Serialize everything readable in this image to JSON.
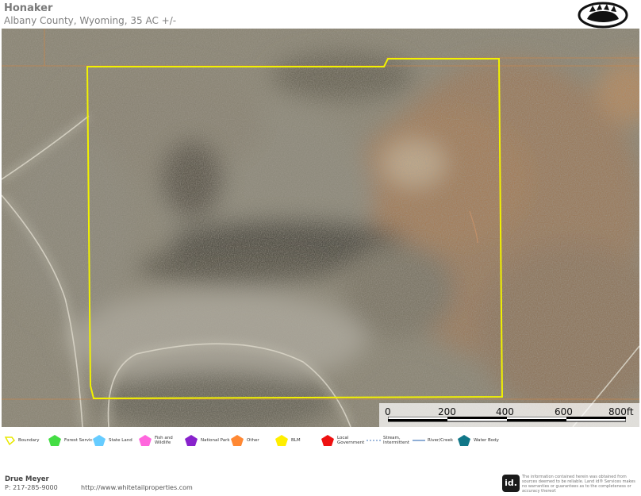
{
  "header": {
    "title": "Honaker",
    "subtitle": "Albany County, Wyoming, 35 AC +/-"
  },
  "scale": {
    "labels": [
      "0",
      "200",
      "400",
      "600",
      "800ft"
    ]
  },
  "legend": {
    "items": [
      {
        "label": "Boundary",
        "color": "#e8e800",
        "shape": "outline"
      },
      {
        "label": "Forest Servic",
        "color": "#44dd44",
        "shape": "pentagon"
      },
      {
        "label": "State Land",
        "color": "#66ccff",
        "shape": "pentagon"
      },
      {
        "label": "Fish and Wildlife",
        "color": "#ff66dd",
        "shape": "pentagon"
      },
      {
        "label": "National Park",
        "color": "#8822cc",
        "shape": "pentagon"
      },
      {
        "label": "Other",
        "color": "#ff8833",
        "shape": "pentagon"
      },
      {
        "label": "BLM",
        "color": "#ffee00",
        "shape": "pentagon"
      },
      {
        "label": "Local Government",
        "color": "#ee1111",
        "shape": "pentagon"
      },
      {
        "label": "Stream, Intermittent",
        "color": "#4477bb",
        "shape": "dashed"
      },
      {
        "label": "River/Creek",
        "color": "#4477bb",
        "shape": "line"
      },
      {
        "label": "Water Body",
        "color": "#117788",
        "shape": "pentagon"
      }
    ]
  },
  "footer": {
    "agent_name": "Drue Meyer",
    "phone": "P: 217-285-9000",
    "website": "http://www.whitetailproperties.com",
    "badge": "id.",
    "disclaimer": "The information contained herein was obtained from sources deemed to be reliable. Land id® Services makes no warranties or guarantees as to the completeness or accuracy thereof."
  },
  "colors": {
    "boundary": "#f2f200",
    "parcel_line": "#c8864a"
  },
  "icons": {
    "logo": "bear-paw-logo"
  }
}
